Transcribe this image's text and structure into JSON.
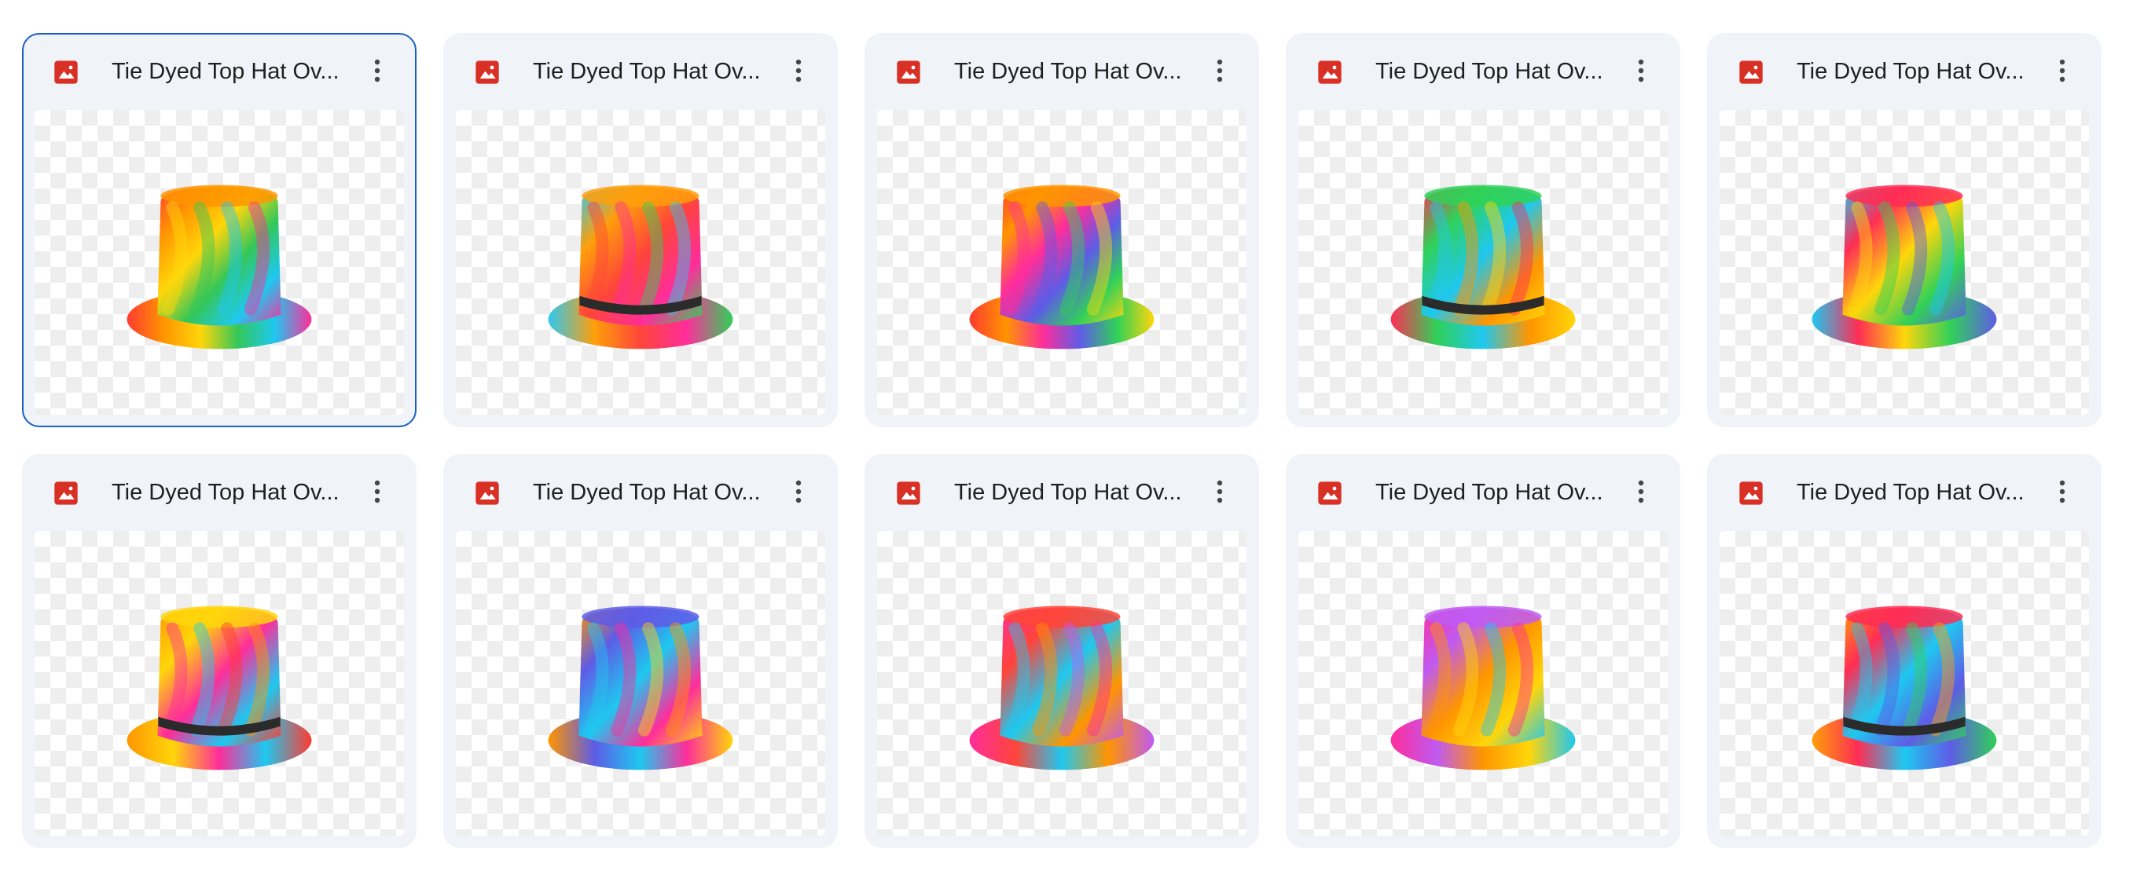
{
  "files": [
    {
      "title": "Tie Dyed Top Hat Ov...",
      "selected": true,
      "hat": {
        "colors": [
          "#ff3b30",
          "#ff9500",
          "#ffd60a",
          "#34c759",
          "#1ec8f0",
          "#ff2d9b"
        ],
        "band": false
      }
    },
    {
      "title": "Tie Dyed Top Hat Ov...",
      "selected": false,
      "hat": {
        "colors": [
          "#2ec8f0",
          "#ff9f0a",
          "#ff453a",
          "#ff2d9b",
          "#30d158"
        ],
        "band": true
      }
    },
    {
      "title": "Tie Dyed Top Hat Ov...",
      "selected": false,
      "hat": {
        "colors": [
          "#ff3b30",
          "#ff9500",
          "#ff2d9b",
          "#5e5ce6",
          "#30d158",
          "#ffd60a"
        ],
        "band": false
      }
    },
    {
      "title": "Tie Dyed Top Hat Ov...",
      "selected": false,
      "hat": {
        "colors": [
          "#ff2d55",
          "#30d158",
          "#1ec8f0",
          "#ff9500",
          "#ffd60a"
        ],
        "band": true
      }
    },
    {
      "title": "Tie Dyed Top Hat Ov...",
      "selected": false,
      "hat": {
        "colors": [
          "#1ec8f0",
          "#ff2d55",
          "#ffd60a",
          "#30d158",
          "#5e5ce6"
        ],
        "band": false
      }
    },
    {
      "title": "Tie Dyed Top Hat Ov...",
      "selected": false,
      "hat": {
        "colors": [
          "#ff9500",
          "#ffd60a",
          "#ff2d9b",
          "#1ec8f0",
          "#ff3b30"
        ],
        "band": true
      }
    },
    {
      "title": "Tie Dyed Top Hat Ov...",
      "selected": false,
      "hat": {
        "colors": [
          "#ff9500",
          "#5e5ce6",
          "#1ec8f0",
          "#ff2d9b",
          "#ffd60a"
        ],
        "band": false
      }
    },
    {
      "title": "Tie Dyed Top Hat Ov...",
      "selected": false,
      "hat": {
        "colors": [
          "#ff2d9b",
          "#ff453a",
          "#1ec8f0",
          "#ff9500",
          "#bf5af2"
        ],
        "band": false
      }
    },
    {
      "title": "Tie Dyed Top Hat Ov...",
      "selected": false,
      "hat": {
        "colors": [
          "#ff2d9b",
          "#bf5af2",
          "#ff9500",
          "#ffd60a",
          "#1ec8f0"
        ],
        "band": false
      }
    },
    {
      "title": "Tie Dyed Top Hat Ov...",
      "selected": false,
      "hat": {
        "colors": [
          "#ff9f0a",
          "#ff2d55",
          "#1ec8f0",
          "#5e5ce6",
          "#30d158"
        ],
        "band": true
      }
    }
  ],
  "icons": {
    "file_type": "image-file-icon",
    "more": "more-vert-icon"
  },
  "colors": {
    "file_icon": "#d93025",
    "selected_border": "#1a5fc1",
    "card_bg": "#f0f4f9"
  }
}
